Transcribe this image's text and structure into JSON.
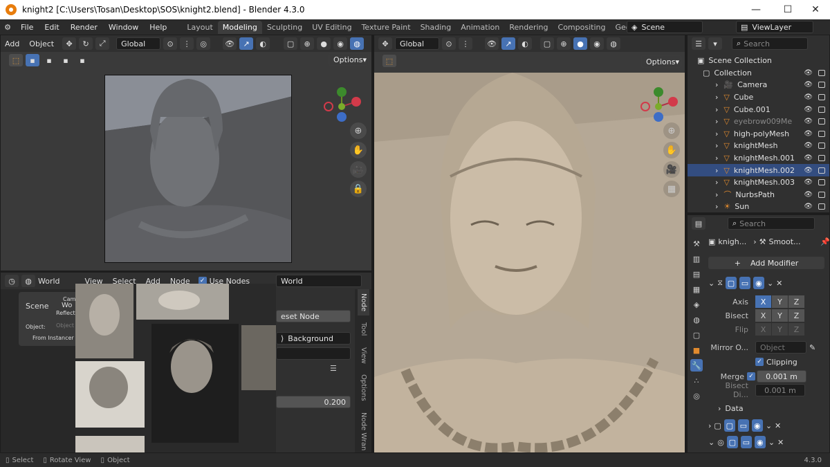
{
  "window": {
    "title": "knight2 [C:\\Users\\Tosan\\Desktop\\SOS\\knight2.blend] - Blender 4.3.0",
    "minimize": "—",
    "maximize": "☐",
    "close": "✕"
  },
  "menu": [
    "File",
    "Edit",
    "Render",
    "Window",
    "Help"
  ],
  "workspaces": [
    "Layout",
    "Modeling",
    "Sculpting",
    "UV Editing",
    "Texture Paint",
    "Shading",
    "Animation",
    "Rendering",
    "Compositing",
    "Geometry Nodes"
  ],
  "active_workspace": "Modeling",
  "scene": "Scene",
  "view_layer": "ViewLayer",
  "left_view": {
    "add": "Add",
    "object": "Object",
    "orient": "Global",
    "options": "Options"
  },
  "right_view": {
    "orient": "Global",
    "options": "Options"
  },
  "outliner": {
    "search": "Search",
    "root": "Scene Collection",
    "collection": "Collection",
    "items": [
      "Camera",
      "Cube",
      "Cube.001",
      "eyebrow009Me",
      "high-polyMesh",
      "knightMesh",
      "knightMesh.001",
      "knightMesh.002",
      "knightMesh.003",
      "NurbsPath",
      "Sun"
    ],
    "selected_index": 7
  },
  "properties": {
    "search": "Search",
    "object": "knigh...",
    "modifier": "Smoot...",
    "add_modifier": "Add Modifier",
    "axis_label": "Axis",
    "bisect_label": "Bisect",
    "flip_label": "Flip",
    "xyz": [
      "X",
      "Y",
      "Z"
    ],
    "mirror_label": "Mirror O...",
    "mirror_placeholder": "Object",
    "clipping": "Clipping",
    "merge_label": "Merge",
    "merge_value": "0.001 m",
    "bisect_dist_label": "Bisect Di...",
    "bisect_dist_value": "0.001 m",
    "data": "Data"
  },
  "node_editor": {
    "world_label": "World",
    "view": "View",
    "select": "Select",
    "add": "Add",
    "node": "Node",
    "use_nodes": "Use Nodes",
    "world_field": "World",
    "tabs": [
      "Node",
      "Tool",
      "View",
      "Options",
      "Node Wran"
    ],
    "reset_node": "eset Node",
    "background": "Background",
    "value": "0.200"
  },
  "scene_popup": {
    "scene": "Scene",
    "wo": "Wo",
    "camera": "Came",
    "reflection": "Reflecti",
    "object_label": "Object:",
    "object_placeholder": "Object",
    "from_instancer": "From Instancer"
  },
  "statusbar": {
    "select": "Select",
    "rotate": "Rotate View",
    "object": "Object",
    "version": "4.3.0"
  },
  "colors": {
    "accent": "#4772b3",
    "mesh_orange": "#e08a2e",
    "panel": "#303030"
  }
}
